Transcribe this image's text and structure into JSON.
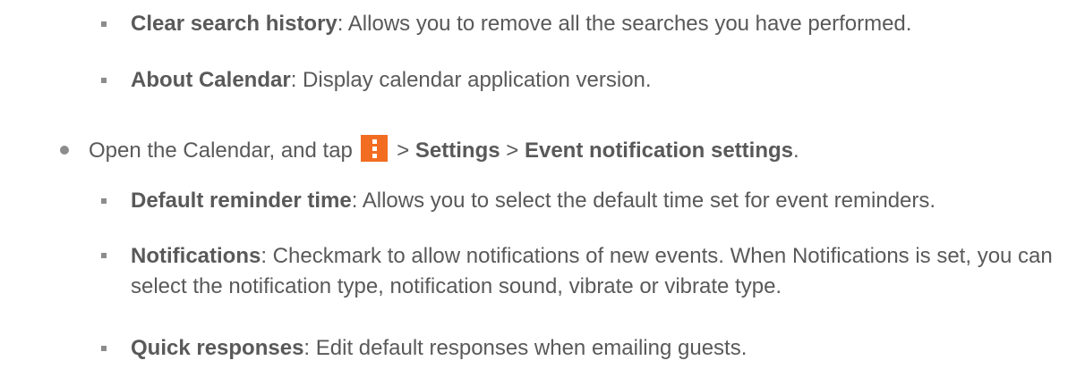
{
  "items": [
    {
      "term": "Clear search history",
      "desc": ": Allows you to remove all the searches you have performed."
    },
    {
      "term": "About Calendar",
      "desc": ": Display calendar application version."
    },
    {
      "step_prefix": "Open the Calendar, and tap",
      "step_sep1": " > ",
      "step_settings": "Settings",
      "step_sep2": " > ",
      "step_event": "Event notification settings",
      "step_end": ".",
      "icon": "more-vertical-menu-icon",
      "icon_color": "#f26d21"
    },
    {
      "term": "Default reminder time",
      "desc": ": Allows you to select the default time set for event reminders."
    },
    {
      "term": "Notifications",
      "desc": ": Checkmark to allow notifications of new events. When Notifications is set, you can select the notification type, notification sound, vibrate or vibrate type."
    },
    {
      "term": "Quick responses",
      "desc": ": Edit default responses when emailing guests."
    }
  ]
}
